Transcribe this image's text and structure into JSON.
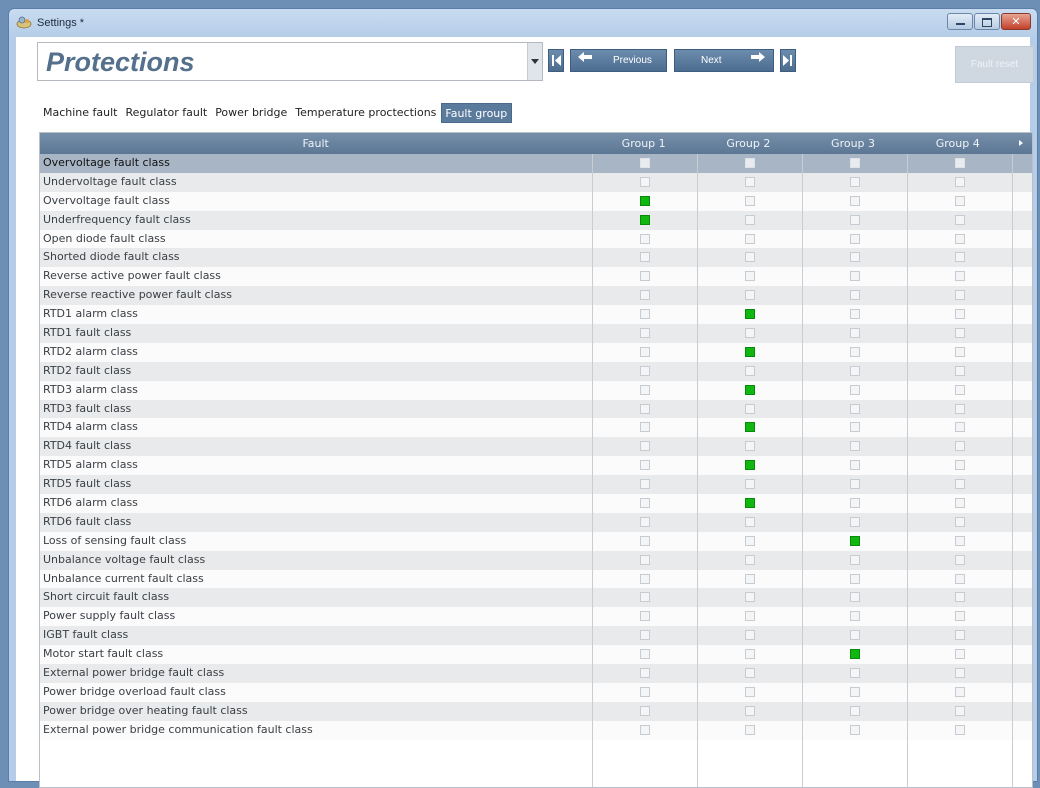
{
  "window": {
    "title": "Settings *"
  },
  "toolbar": {
    "page_selector": "Protections",
    "previous_label": "Previous",
    "next_label": "Next",
    "fault_reset_label": "Fault reset"
  },
  "tabs": [
    {
      "label": "Machine fault",
      "active": false
    },
    {
      "label": "Regulator fault",
      "active": false
    },
    {
      "label": "Power bridge",
      "active": false
    },
    {
      "label": "Temperature proctections",
      "active": false
    },
    {
      "label": "Fault group",
      "active": true
    }
  ],
  "grid": {
    "columns": [
      "Fault",
      "Group 1",
      "Group 2",
      "Group 3",
      "Group 4"
    ],
    "rows": [
      {
        "name": "Overvoltage fault class",
        "groups": [
          false,
          false,
          false,
          false
        ],
        "selected": true
      },
      {
        "name": "Undervoltage fault class",
        "groups": [
          false,
          false,
          false,
          false
        ]
      },
      {
        "name": "Overvoltage fault class",
        "groups": [
          true,
          false,
          false,
          false
        ]
      },
      {
        "name": "Underfrequency fault class",
        "groups": [
          true,
          false,
          false,
          false
        ]
      },
      {
        "name": "Open diode fault class",
        "groups": [
          false,
          false,
          false,
          false
        ]
      },
      {
        "name": "Shorted diode fault class",
        "groups": [
          false,
          false,
          false,
          false
        ]
      },
      {
        "name": "Reverse active power fault class",
        "groups": [
          false,
          false,
          false,
          false
        ]
      },
      {
        "name": "Reverse reactive power fault class",
        "groups": [
          false,
          false,
          false,
          false
        ]
      },
      {
        "name": "RTD1 alarm class",
        "groups": [
          false,
          true,
          false,
          false
        ]
      },
      {
        "name": "RTD1 fault class",
        "groups": [
          false,
          false,
          false,
          false
        ]
      },
      {
        "name": "RTD2 alarm class",
        "groups": [
          false,
          true,
          false,
          false
        ]
      },
      {
        "name": "RTD2 fault class",
        "groups": [
          false,
          false,
          false,
          false
        ]
      },
      {
        "name": "RTD3 alarm class",
        "groups": [
          false,
          true,
          false,
          false
        ]
      },
      {
        "name": "RTD3 fault class",
        "groups": [
          false,
          false,
          false,
          false
        ]
      },
      {
        "name": "RTD4 alarm class",
        "groups": [
          false,
          true,
          false,
          false
        ]
      },
      {
        "name": "RTD4 fault class",
        "groups": [
          false,
          false,
          false,
          false
        ]
      },
      {
        "name": "RTD5 alarm class",
        "groups": [
          false,
          true,
          false,
          false
        ]
      },
      {
        "name": "RTD5 fault class",
        "groups": [
          false,
          false,
          false,
          false
        ]
      },
      {
        "name": "RTD6 alarm class",
        "groups": [
          false,
          true,
          false,
          false
        ]
      },
      {
        "name": "RTD6 fault class",
        "groups": [
          false,
          false,
          false,
          false
        ]
      },
      {
        "name": "Loss of sensing fault class",
        "groups": [
          false,
          false,
          true,
          false
        ]
      },
      {
        "name": "Unbalance voltage fault class",
        "groups": [
          false,
          false,
          false,
          false
        ]
      },
      {
        "name": "Unbalance current fault class",
        "groups": [
          false,
          false,
          false,
          false
        ]
      },
      {
        "name": "Short circuit fault class",
        "groups": [
          false,
          false,
          false,
          false
        ]
      },
      {
        "name": "Power supply fault class",
        "groups": [
          false,
          false,
          false,
          false
        ]
      },
      {
        "name": "IGBT fault class",
        "groups": [
          false,
          false,
          false,
          false
        ]
      },
      {
        "name": "Motor start fault class",
        "groups": [
          false,
          false,
          true,
          false
        ]
      },
      {
        "name": "External power bridge fault class",
        "groups": [
          false,
          false,
          false,
          false
        ]
      },
      {
        "name": "Power bridge overload fault class",
        "groups": [
          false,
          false,
          false,
          false
        ]
      },
      {
        "name": "Power bridge over heating fault class",
        "groups": [
          false,
          false,
          false,
          false
        ]
      },
      {
        "name": "External power bridge communication fault class",
        "groups": [
          false,
          false,
          false,
          false
        ]
      }
    ]
  },
  "colors": {
    "checked": "#0fb70f",
    "header": "#5c7795",
    "active_tab": "#5b7b9c"
  },
  "icons": {
    "app": "settings-app-icon",
    "first": "first-page-icon",
    "previous": "arrow-left-icon",
    "next": "arrow-right-icon",
    "last": "last-page-icon"
  }
}
